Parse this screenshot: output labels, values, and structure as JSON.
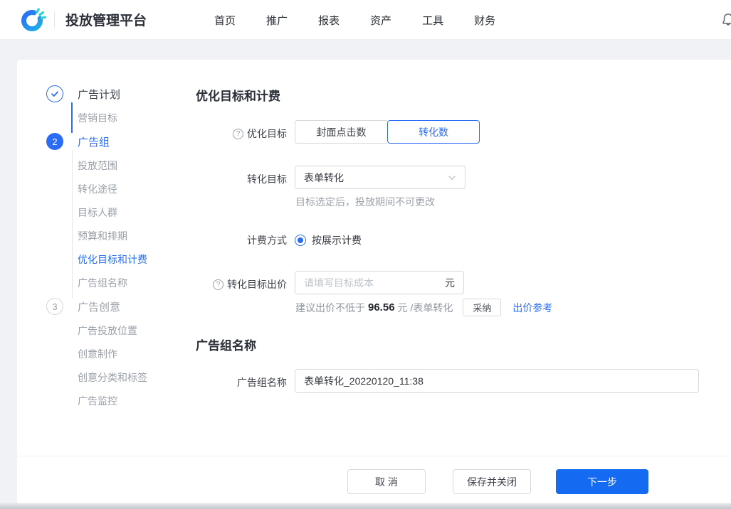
{
  "colors": {
    "accent": "#2a6cf6",
    "primary_button": "#156af2",
    "link": "#2a6cf6"
  },
  "header": {
    "brand": "投放管理平台",
    "nav": [
      "首页",
      "推广",
      "报表",
      "资产",
      "工具",
      "财务"
    ],
    "bell_icon": "bell-icon"
  },
  "sidebar": {
    "items": [
      {
        "type": "step",
        "num": "1",
        "state": "done",
        "label": "广告计划"
      },
      {
        "type": "sub",
        "state": "normal",
        "label": "营销目标"
      },
      {
        "type": "step",
        "num": "2",
        "state": "current",
        "label": "广告组"
      },
      {
        "type": "sub",
        "state": "normal",
        "label": "投放范围"
      },
      {
        "type": "sub",
        "state": "normal",
        "label": "转化途径"
      },
      {
        "type": "sub",
        "state": "normal",
        "label": "目标人群"
      },
      {
        "type": "sub",
        "state": "normal",
        "label": "预算和排期"
      },
      {
        "type": "sub",
        "state": "active",
        "label": "优化目标和计费"
      },
      {
        "type": "sub",
        "state": "normal",
        "label": "广告组名称"
      },
      {
        "type": "step",
        "num": "3",
        "state": "todo",
        "label": "广告创意"
      },
      {
        "type": "sub",
        "state": "normal",
        "label": "广告投放位置"
      },
      {
        "type": "sub",
        "state": "normal",
        "label": "创意制作"
      },
      {
        "type": "sub",
        "state": "normal",
        "label": "创意分类和标签"
      },
      {
        "type": "sub",
        "state": "normal",
        "label": "广告监控"
      }
    ]
  },
  "main": {
    "section1_title": "优化目标和计费",
    "goal": {
      "label": "优化目标",
      "options": [
        "封面点击数",
        "转化数"
      ],
      "selected": "转化数"
    },
    "conversion": {
      "label": "转化目标",
      "value": "表单转化",
      "hint": "目标选定后，投放期间不可更改"
    },
    "billing": {
      "label": "计费方式",
      "option": "按展示计费",
      "checked": true
    },
    "bid": {
      "label": "转化目标出价",
      "placeholder": "请填写目标成本",
      "unit": "元",
      "suggest_prefix": "建议出价不低于",
      "suggest_value": "96.56",
      "suggest_suffix": "元 /表单转化",
      "adopt_label": "采纳",
      "reference_label": "出价参考"
    },
    "section2_title": "广告组名称",
    "group_name": {
      "label": "广告组名称",
      "value": "表单转化_20220120_11:38"
    }
  },
  "footer": {
    "cancel_label": "取 消",
    "save_close_label": "保存并关闭",
    "next_label": "下一步"
  }
}
